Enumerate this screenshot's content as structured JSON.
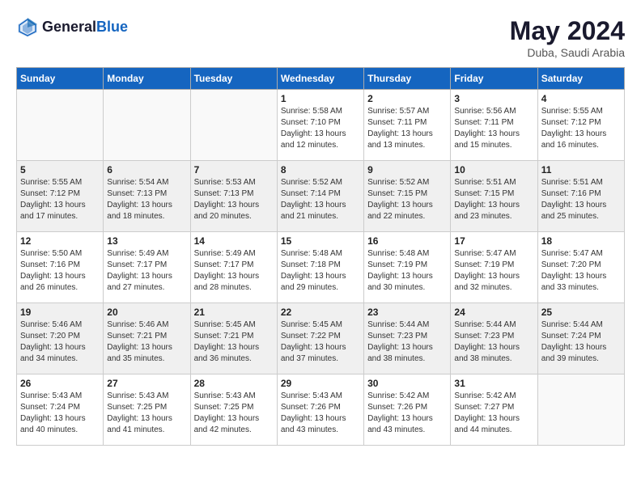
{
  "header": {
    "logo_general": "General",
    "logo_blue": "Blue",
    "month_year": "May 2024",
    "location": "Duba, Saudi Arabia"
  },
  "days_of_week": [
    "Sunday",
    "Monday",
    "Tuesday",
    "Wednesday",
    "Thursday",
    "Friday",
    "Saturday"
  ],
  "weeks": [
    [
      {
        "day": "",
        "empty": true
      },
      {
        "day": "",
        "empty": true
      },
      {
        "day": "",
        "empty": true
      },
      {
        "day": "1",
        "sunrise": "Sunrise: 5:58 AM",
        "sunset": "Sunset: 7:10 PM",
        "daylight": "Daylight: 13 hours and 12 minutes."
      },
      {
        "day": "2",
        "sunrise": "Sunrise: 5:57 AM",
        "sunset": "Sunset: 7:11 PM",
        "daylight": "Daylight: 13 hours and 13 minutes."
      },
      {
        "day": "3",
        "sunrise": "Sunrise: 5:56 AM",
        "sunset": "Sunset: 7:11 PM",
        "daylight": "Daylight: 13 hours and 15 minutes."
      },
      {
        "day": "4",
        "sunrise": "Sunrise: 5:55 AM",
        "sunset": "Sunset: 7:12 PM",
        "daylight": "Daylight: 13 hours and 16 minutes."
      }
    ],
    [
      {
        "day": "5",
        "sunrise": "Sunrise: 5:55 AM",
        "sunset": "Sunset: 7:12 PM",
        "daylight": "Daylight: 13 hours and 17 minutes."
      },
      {
        "day": "6",
        "sunrise": "Sunrise: 5:54 AM",
        "sunset": "Sunset: 7:13 PM",
        "daylight": "Daylight: 13 hours and 18 minutes."
      },
      {
        "day": "7",
        "sunrise": "Sunrise: 5:53 AM",
        "sunset": "Sunset: 7:13 PM",
        "daylight": "Daylight: 13 hours and 20 minutes."
      },
      {
        "day": "8",
        "sunrise": "Sunrise: 5:52 AM",
        "sunset": "Sunset: 7:14 PM",
        "daylight": "Daylight: 13 hours and 21 minutes."
      },
      {
        "day": "9",
        "sunrise": "Sunrise: 5:52 AM",
        "sunset": "Sunset: 7:15 PM",
        "daylight": "Daylight: 13 hours and 22 minutes."
      },
      {
        "day": "10",
        "sunrise": "Sunrise: 5:51 AM",
        "sunset": "Sunset: 7:15 PM",
        "daylight": "Daylight: 13 hours and 23 minutes."
      },
      {
        "day": "11",
        "sunrise": "Sunrise: 5:51 AM",
        "sunset": "Sunset: 7:16 PM",
        "daylight": "Daylight: 13 hours and 25 minutes."
      }
    ],
    [
      {
        "day": "12",
        "sunrise": "Sunrise: 5:50 AM",
        "sunset": "Sunset: 7:16 PM",
        "daylight": "Daylight: 13 hours and 26 minutes."
      },
      {
        "day": "13",
        "sunrise": "Sunrise: 5:49 AM",
        "sunset": "Sunset: 7:17 PM",
        "daylight": "Daylight: 13 hours and 27 minutes."
      },
      {
        "day": "14",
        "sunrise": "Sunrise: 5:49 AM",
        "sunset": "Sunset: 7:17 PM",
        "daylight": "Daylight: 13 hours and 28 minutes."
      },
      {
        "day": "15",
        "sunrise": "Sunrise: 5:48 AM",
        "sunset": "Sunset: 7:18 PM",
        "daylight": "Daylight: 13 hours and 29 minutes."
      },
      {
        "day": "16",
        "sunrise": "Sunrise: 5:48 AM",
        "sunset": "Sunset: 7:19 PM",
        "daylight": "Daylight: 13 hours and 30 minutes."
      },
      {
        "day": "17",
        "sunrise": "Sunrise: 5:47 AM",
        "sunset": "Sunset: 7:19 PM",
        "daylight": "Daylight: 13 hours and 32 minutes."
      },
      {
        "day": "18",
        "sunrise": "Sunrise: 5:47 AM",
        "sunset": "Sunset: 7:20 PM",
        "daylight": "Daylight: 13 hours and 33 minutes."
      }
    ],
    [
      {
        "day": "19",
        "sunrise": "Sunrise: 5:46 AM",
        "sunset": "Sunset: 7:20 PM",
        "daylight": "Daylight: 13 hours and 34 minutes."
      },
      {
        "day": "20",
        "sunrise": "Sunrise: 5:46 AM",
        "sunset": "Sunset: 7:21 PM",
        "daylight": "Daylight: 13 hours and 35 minutes."
      },
      {
        "day": "21",
        "sunrise": "Sunrise: 5:45 AM",
        "sunset": "Sunset: 7:21 PM",
        "daylight": "Daylight: 13 hours and 36 minutes."
      },
      {
        "day": "22",
        "sunrise": "Sunrise: 5:45 AM",
        "sunset": "Sunset: 7:22 PM",
        "daylight": "Daylight: 13 hours and 37 minutes."
      },
      {
        "day": "23",
        "sunrise": "Sunrise: 5:44 AM",
        "sunset": "Sunset: 7:23 PM",
        "daylight": "Daylight: 13 hours and 38 minutes."
      },
      {
        "day": "24",
        "sunrise": "Sunrise: 5:44 AM",
        "sunset": "Sunset: 7:23 PM",
        "daylight": "Daylight: 13 hours and 38 minutes."
      },
      {
        "day": "25",
        "sunrise": "Sunrise: 5:44 AM",
        "sunset": "Sunset: 7:24 PM",
        "daylight": "Daylight: 13 hours and 39 minutes."
      }
    ],
    [
      {
        "day": "26",
        "sunrise": "Sunrise: 5:43 AM",
        "sunset": "Sunset: 7:24 PM",
        "daylight": "Daylight: 13 hours and 40 minutes."
      },
      {
        "day": "27",
        "sunrise": "Sunrise: 5:43 AM",
        "sunset": "Sunset: 7:25 PM",
        "daylight": "Daylight: 13 hours and 41 minutes."
      },
      {
        "day": "28",
        "sunrise": "Sunrise: 5:43 AM",
        "sunset": "Sunset: 7:25 PM",
        "daylight": "Daylight: 13 hours and 42 minutes."
      },
      {
        "day": "29",
        "sunrise": "Sunrise: 5:43 AM",
        "sunset": "Sunset: 7:26 PM",
        "daylight": "Daylight: 13 hours and 43 minutes."
      },
      {
        "day": "30",
        "sunrise": "Sunrise: 5:42 AM",
        "sunset": "Sunset: 7:26 PM",
        "daylight": "Daylight: 13 hours and 43 minutes."
      },
      {
        "day": "31",
        "sunrise": "Sunrise: 5:42 AM",
        "sunset": "Sunset: 7:27 PM",
        "daylight": "Daylight: 13 hours and 44 minutes."
      },
      {
        "day": "",
        "empty": true
      }
    ]
  ]
}
